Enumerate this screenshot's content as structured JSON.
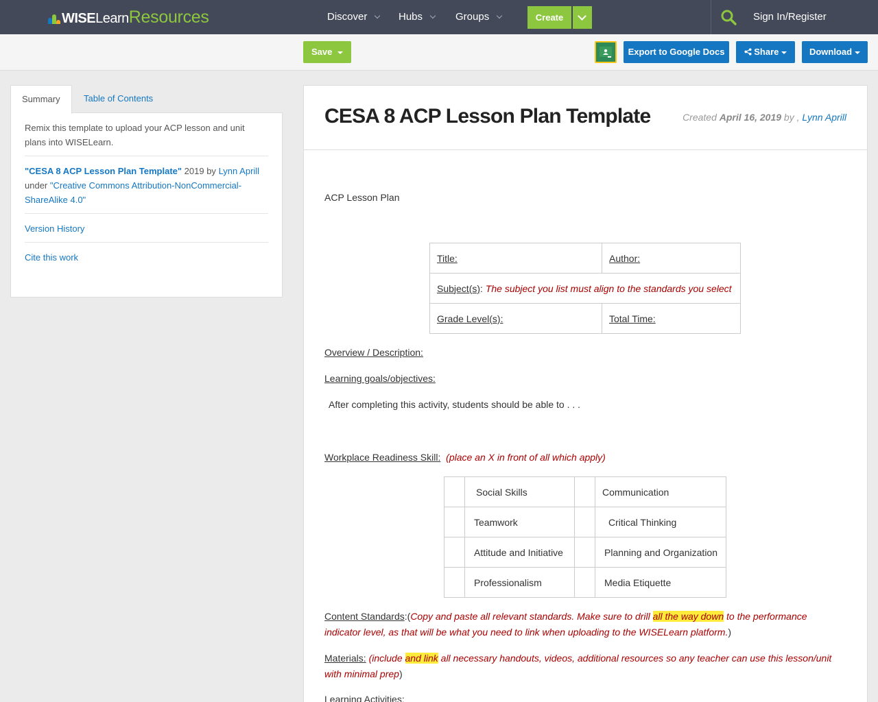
{
  "nav": {
    "logo_wise": "WISE",
    "logo_learn": "Learn",
    "logo_resources": "Resources",
    "discover": "Discover",
    "hubs": "Hubs",
    "groups": "Groups",
    "create": "Create",
    "signin": "Sign In/Register"
  },
  "toolbar": {
    "save": "Save",
    "export": "Export to Google Docs",
    "share": "Share",
    "download": "Download"
  },
  "sidebar": {
    "tab_summary": "Summary",
    "tab_toc": "Table of Contents",
    "description": "Remix this template to upload your ACP lesson and unit plans into WISELearn.",
    "work_title": "\"CESA 8 ACP Lesson Plan Template\"",
    "work_year_by": " 2019 by ",
    "work_author": "Lynn Aprill",
    "under": "under ",
    "license": "\"Creative Commons Attribution-NonCommercial-ShareAlike 4.0\"",
    "version_history": "Version History",
    "cite": "Cite this work"
  },
  "main": {
    "title": "CESA 8 ACP Lesson Plan Template",
    "created_label": "Created ",
    "created_date": "April 16, 2019",
    "created_by": " by , ",
    "created_author": "Lynn Aprill",
    "acp_heading": "ACP Lesson Plan",
    "info_table": {
      "title": "Title:",
      "author": "Author:",
      "subject": "Subject(s)",
      "subject_colon": ":  ",
      "subject_note": "The subject you list must align to the standards you select",
      "grade": "Grade Level(s):",
      "time": "Total Time:"
    },
    "overview": "Overview / Description:",
    "goals": "Learning goals/objectives:",
    "after": "After completing this activity, students should be able to . . .",
    "workplace": "Workplace Readiness Skill:",
    "workplace_note": "(place an X in front of all which apply)",
    "skills": [
      [
        "Social Skills",
        "Communication"
      ],
      [
        "Teamwork",
        "Critical Thinking"
      ],
      [
        "Attitude and Initiative",
        "Planning and Organization"
      ],
      [
        "Professionalism",
        "Media Etiquette"
      ]
    ],
    "content_standards": "Content Standards",
    "cs_open": ":(",
    "cs_note1": "Copy and paste all relevant standards. Make sure to drill ",
    "cs_hl": "all the way down",
    "cs_note2": " to the performance indicator level, as that will be what you need to link when uploading to the WISELearn platform.",
    "cs_close": ")",
    "materials": "Materials:",
    "mat_note1": " (include ",
    "mat_hl": "and link",
    "mat_note2": " all necessary handouts, videos, additional resources so any teacher can use this lesson/unit with minimal prep",
    "mat_close": ")",
    "learning_activities": "Learning Activities:"
  }
}
